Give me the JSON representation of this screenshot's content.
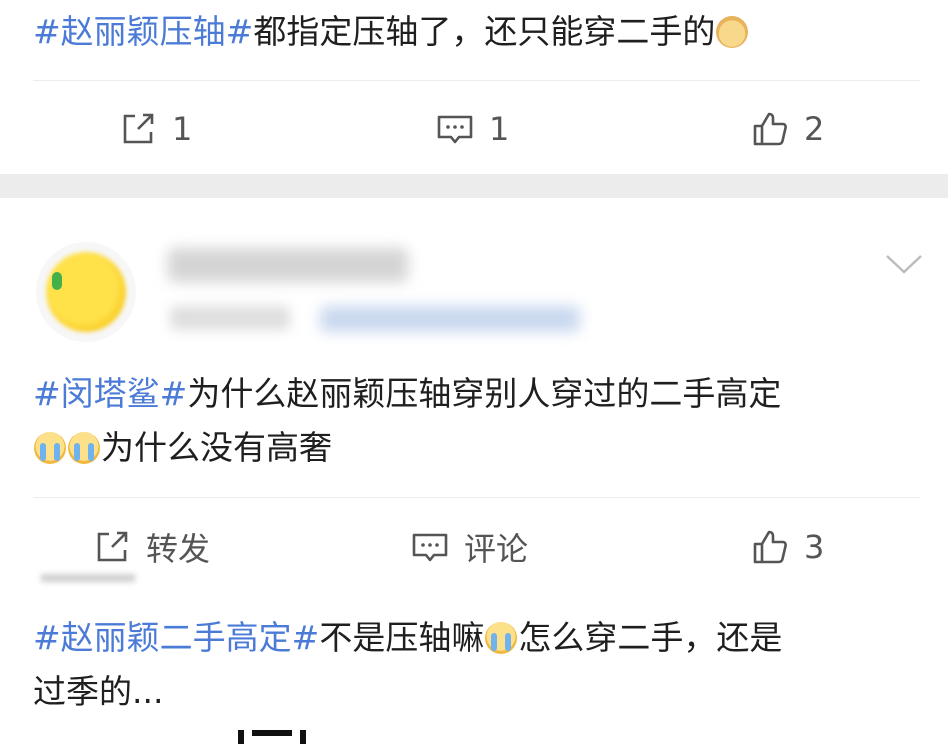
{
  "post1": {
    "hashtag": "#赵丽颖压轴#",
    "body": "都指定压轴了，还只能穿二手的",
    "emoji_icon": "doge-emoji-icon",
    "actions": {
      "repost_count": "1",
      "comment_count": "1",
      "like_count": "2"
    }
  },
  "post2": {
    "avatar_icon": "yellow-avatar",
    "hashtag": "#闵塔鲨#",
    "body_line1": "为什么赵丽颖压轴穿别人穿过的二手高定",
    "body_line2": "为什么没有高奢",
    "emoji_icon": "crying-emoji-icon",
    "actions": {
      "repost_label": "转发",
      "comment_label": "评论",
      "like_count": "3"
    }
  },
  "post3": {
    "hashtag": "#赵丽颖二手高定#",
    "body_part1": "不是压轴嘛",
    "body_part2": "怎么穿二手，还是",
    "body_line2": "过季的...",
    "emoji_icon": "crying-emoji-icon"
  },
  "colors": {
    "hashtag": "#4b7bd6",
    "text": "#1f1f1f",
    "icon": "#555555",
    "separator": "#ececec"
  }
}
